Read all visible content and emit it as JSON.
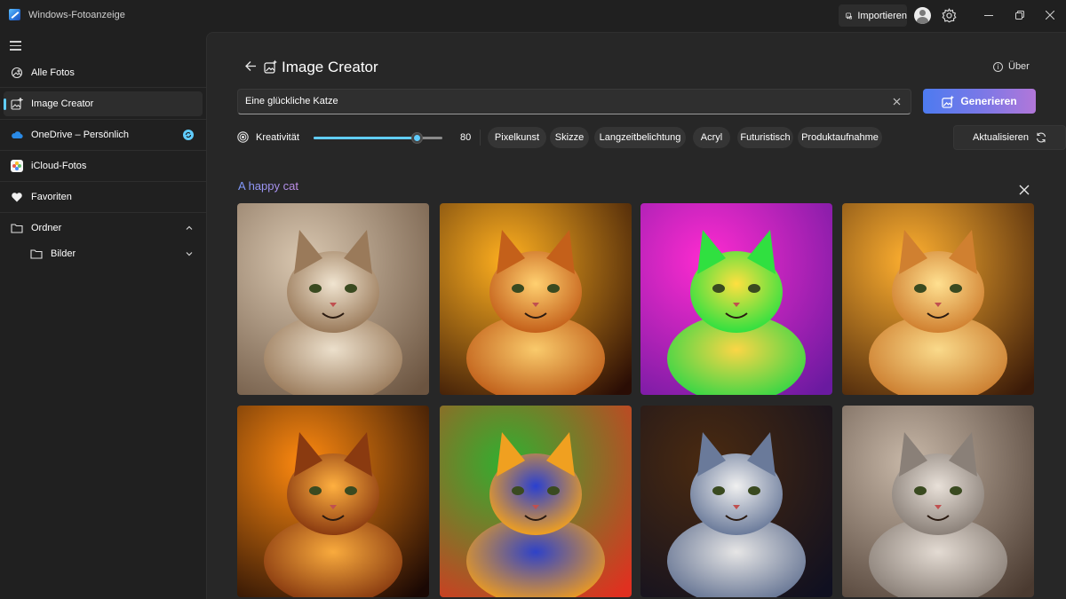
{
  "window": {
    "app_title": "Windows-Fotoanzeige",
    "import_label": "Importieren",
    "minimize_icon": "minimize-icon",
    "maximize_icon": "restore-icon",
    "close_icon": "close-icon"
  },
  "sidebar": {
    "items": [
      {
        "label": "Alle Fotos",
        "icon": "photos-icon"
      },
      {
        "label": "Image Creator",
        "icon": "image-creator-icon",
        "active": true
      },
      {
        "label": "OneDrive – Persönlich",
        "icon": "cloud-icon"
      },
      {
        "label": "iCloud-Fotos",
        "icon": "icloud-photos-icon"
      },
      {
        "label": "Favoriten",
        "icon": "heart-icon"
      },
      {
        "label": "Ordner",
        "icon": "folder-icon"
      },
      {
        "label": "Bilder",
        "icon": "folder-icon"
      }
    ]
  },
  "main": {
    "title": "Image Creator",
    "about_label": "Über",
    "prompt_value": "Eine glückliche Katze",
    "generate_label": "Generieren",
    "creativity_label": "Kreativität",
    "creativity_value": 80,
    "creativity_max": 100,
    "styles": [
      "Pixelkunst",
      "Skizze",
      "Langzeitbelichtung",
      "Acryl",
      "Futuristisch",
      "Produktaufnahme"
    ],
    "refresh_label": "Aktualisieren",
    "result_title": "A happy cat"
  },
  "colors": {
    "accent": "#60cdff",
    "generate_gradient_start": "#4d7bf0",
    "generate_gradient_end": "#b277d9"
  },
  "images": [
    {
      "name": "tabby-cat-closeup",
      "bg1": "#d9c7b0",
      "bg2": "#6b5440",
      "fur": "#9a7a5a",
      "glow": "#f0e4d0"
    },
    {
      "name": "cat-in-sunbeam",
      "bg1": "#ffb020",
      "bg2": "#2a0d05",
      "fur": "#c4601a",
      "glow": "#ffd070"
    },
    {
      "name": "neon-pink-green-cat",
      "bg1": "#ff2bd0",
      "bg2": "#6a1aa0",
      "fur": "#30e040",
      "glow": "#ffe040"
    },
    {
      "name": "cat-by-window",
      "bg1": "#ffb030",
      "bg2": "#3a1a08",
      "fur": "#d08030",
      "glow": "#ffe090"
    },
    {
      "name": "backlit-fluffy-cat",
      "bg1": "#ff8a10",
      "bg2": "#1a0804",
      "fur": "#8a3a10",
      "glow": "#ffb040"
    },
    {
      "name": "rainbow-cat",
      "bg1": "#30b030",
      "bg2": "#e03020",
      "fur": "#f0a020",
      "glow": "#2a40d0"
    },
    {
      "name": "meowing-colorful-cat",
      "bg1": "#4a2a10",
      "bg2": "#101020",
      "fur": "#6a7a9a",
      "glow": "#f0f0f0"
    },
    {
      "name": "grey-fluffy-cat",
      "bg1": "#c8b8a8",
      "bg2": "#4a3a30",
      "fur": "#8a8078",
      "glow": "#e8e0d8"
    }
  ]
}
